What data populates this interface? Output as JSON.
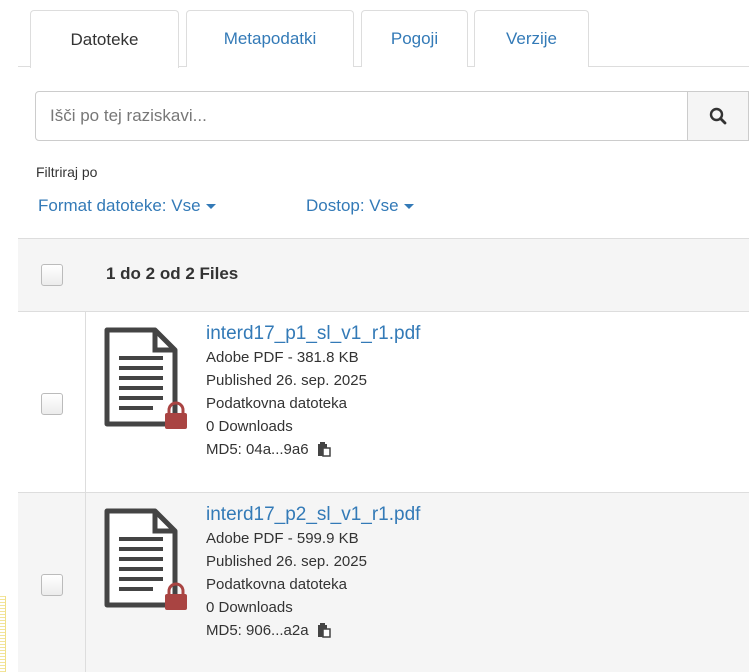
{
  "tabs": [
    {
      "label": "Datoteke",
      "active": true
    },
    {
      "label": "Metapodatki",
      "active": false
    },
    {
      "label": "Pogoji",
      "active": false
    },
    {
      "label": "Verzije",
      "active": false
    }
  ],
  "search": {
    "placeholder": "Išči po tej raziskavi...",
    "icon": "search-icon"
  },
  "filters": {
    "title": "Filtriraj po",
    "format_label": "Format datoteke: Vse",
    "access_label": "Dostop: Vse"
  },
  "table": {
    "header": "1 do 2 od 2 Files",
    "files": [
      {
        "name": "interd17_p1_sl_v1_r1.pdf",
        "type_size": "Adobe PDF - 381.8 KB",
        "published": "Published 26. sep. 2025",
        "category": "Podatkovna datoteka",
        "downloads": "0 Downloads",
        "md5": "MD5: 04a...9a6",
        "icons": [
          "file-text-icon",
          "lock-icon",
          "clipboard-icon"
        ]
      },
      {
        "name": "interd17_p2_sl_v1_r1.pdf",
        "type_size": "Adobe PDF - 599.9 KB",
        "published": "Published 26. sep. 2025",
        "category": "Podatkovna datoteka",
        "downloads": "0 Downloads",
        "md5": "MD5: 906...a2a",
        "icons": [
          "file-text-icon",
          "lock-icon",
          "clipboard-icon"
        ]
      }
    ]
  },
  "colors": {
    "link": "#337ab7",
    "lock": "#a94442",
    "header_bg": "#f5f5f5"
  }
}
